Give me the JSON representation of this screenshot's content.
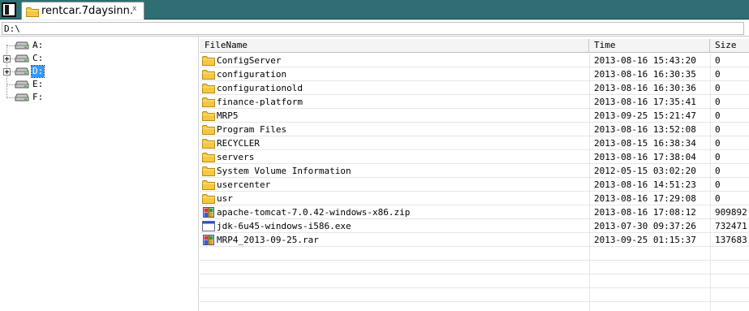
{
  "tabbar": {
    "tab_title": "rentcar.7daysinn.",
    "close_glyph": "x"
  },
  "path": {
    "value": "D:\\"
  },
  "tree": {
    "drives": [
      {
        "label": "A:",
        "expandable": false,
        "selected": false
      },
      {
        "label": "C:",
        "expandable": true,
        "selected": false
      },
      {
        "label": "D:",
        "expandable": true,
        "selected": true
      },
      {
        "label": "E:",
        "expandable": false,
        "selected": false
      },
      {
        "label": "F:",
        "expandable": false,
        "selected": false
      }
    ]
  },
  "list": {
    "columns": {
      "name": "FileName",
      "time": "Time",
      "size": "Size"
    },
    "rows": [
      {
        "icon": "folder-icon",
        "name": "ConfigServer",
        "time": "2013-08-16 15:43:20",
        "size": "0"
      },
      {
        "icon": "folder-icon",
        "name": "configuration",
        "time": "2013-08-16 16:30:35",
        "size": "0"
      },
      {
        "icon": "folder-icon",
        "name": "configurationold",
        "time": "2013-08-16 16:30:36",
        "size": "0"
      },
      {
        "icon": "folder-icon",
        "name": "finance-platform",
        "time": "2013-08-16 17:35:41",
        "size": "0"
      },
      {
        "icon": "folder-icon",
        "name": "MRP5",
        "time": "2013-09-25 15:21:47",
        "size": "0"
      },
      {
        "icon": "folder-icon",
        "name": "Program Files",
        "time": "2013-08-16 13:52:08",
        "size": "0"
      },
      {
        "icon": "folder-icon",
        "name": "RECYCLER",
        "time": "2013-08-15 16:38:34",
        "size": "0"
      },
      {
        "icon": "folder-icon",
        "name": "servers",
        "time": "2013-08-16 17:38:04",
        "size": "0"
      },
      {
        "icon": "folder-icon",
        "name": "System Volume Information",
        "time": "2012-05-15 03:02:20",
        "size": "0"
      },
      {
        "icon": "folder-icon",
        "name": "usercenter",
        "time": "2013-08-16 14:51:23",
        "size": "0"
      },
      {
        "icon": "folder-icon",
        "name": "usr",
        "time": "2013-08-16 17:29:08",
        "size": "0"
      },
      {
        "icon": "archive-icon",
        "name": "apache-tomcat-7.0.42-windows-x86.zip",
        "time": "2013-08-16 17:08:12",
        "size": "909892"
      },
      {
        "icon": "exe-icon",
        "name": "jdk-6u45-windows-i586.exe",
        "time": "2013-07-30 09:37:26",
        "size": "732471"
      },
      {
        "icon": "archive-icon",
        "name": "MRP4_2013-09-25.rar",
        "time": "2013-09-25 01:15:37",
        "size": "137683"
      }
    ]
  },
  "colors": {
    "tabbar_bg": "#2f6f73",
    "selection": "#3399ff",
    "folder": "#f5c842"
  }
}
